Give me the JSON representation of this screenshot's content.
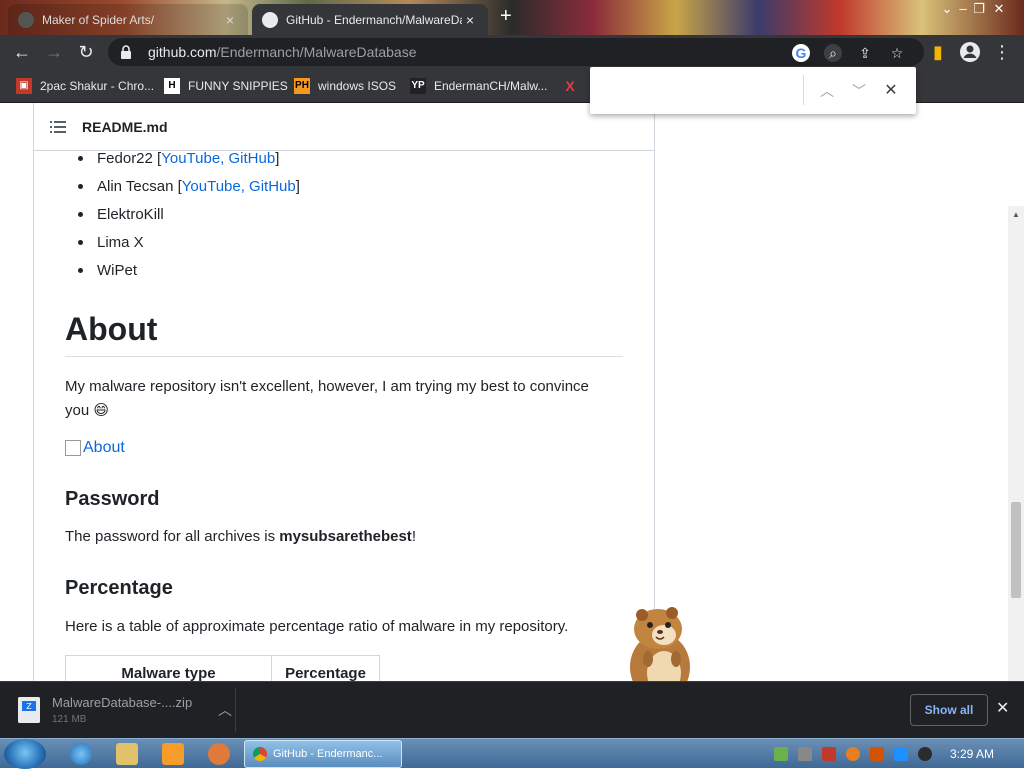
{
  "browser": {
    "tabs": [
      {
        "title": "Maker of Spider Arts/",
        "active": false
      },
      {
        "title": "GitHub - Endermanch/MalwareDatabase",
        "active": true
      }
    ],
    "url_host": "github.com",
    "url_path": "/Endermanch/MalwareDatabase"
  },
  "bookmarks": [
    {
      "label": "2pac Shakur - Chro...",
      "icon": "tupac-bookmark-icon"
    },
    {
      "label": "FUNNY SNIPPIES",
      "icon": "h-bookmark-icon"
    },
    {
      "label": "windows ISOS",
      "icon": "ph-bookmark-icon"
    },
    {
      "label": "EndermanCH/Malw...",
      "icon": "yp-bookmark-icon"
    },
    {
      "label": "X",
      "icon": "x-bookmark-icon"
    }
  ],
  "find_bar": {
    "value": ""
  },
  "readme": {
    "filename": "README.md",
    "contributors": [
      {
        "name": "Fedor22 [",
        "links": "YouTube, GitHub",
        "close": "]"
      },
      {
        "name": "Alin Tecsan [",
        "links": "YouTube, GitHub",
        "close": "]"
      },
      {
        "name": "ElektroKill"
      },
      {
        "name": "Lima X"
      },
      {
        "name": "WiPet"
      }
    ],
    "about_heading": "About",
    "about_text": "My malware repository isn't excellent, however, I am trying my best to convince you 😄",
    "about_image_alt": "About",
    "password_heading": "Password",
    "password_text_prefix": "The password for all archives is ",
    "password_value": "mysubsarethebest",
    "password_text_suffix": "!",
    "percentage_heading": "Percentage",
    "percentage_text": "Here is a table of approximate percentage ratio of malware in my repository.",
    "table_headers": [
      "Malware type",
      "Percentage"
    ]
  },
  "downloads": {
    "file_name": "MalwareDatabase-....zip",
    "file_size": "121 MB",
    "show_all_label": "Show all"
  },
  "taskbar": {
    "active_window": "GitHub - Endermanc...",
    "clock": "3:29 AM"
  }
}
